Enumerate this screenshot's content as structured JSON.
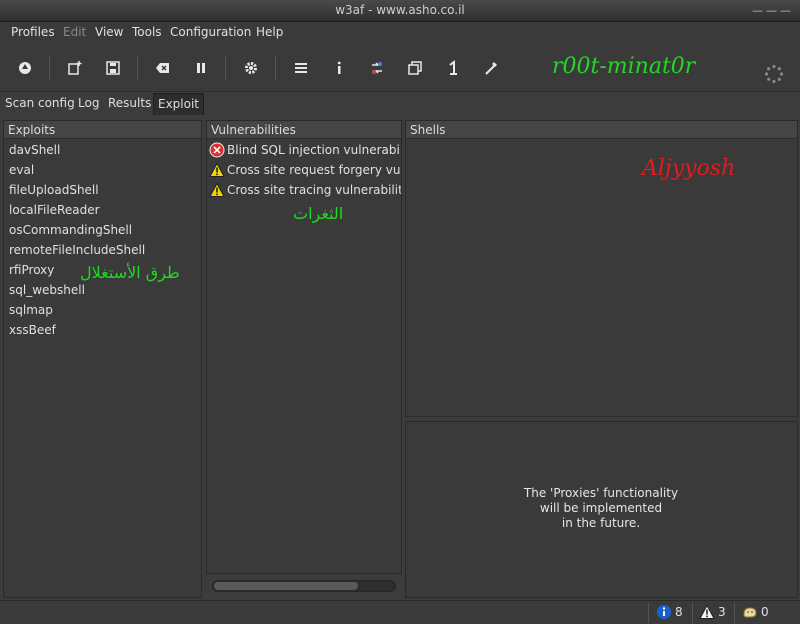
{
  "window": {
    "title": "w3af - www.asho.co.il",
    "controls": "———"
  },
  "menu": {
    "items": [
      {
        "label": "Profiles",
        "enabled": true
      },
      {
        "label": "Edit",
        "enabled": false
      },
      {
        "label": "View",
        "enabled": true
      },
      {
        "label": "Tools",
        "enabled": true
      },
      {
        "label": "Configuration",
        "enabled": true
      },
      {
        "label": "Help",
        "enabled": true
      }
    ]
  },
  "toolbar": {
    "brand_text": "r00t-minat0r",
    "buttons": [
      "start-icon",
      "new-profile-icon",
      "save-icon",
      "clear-icon",
      "pause-icon",
      "settings-icon",
      "list-icon",
      "info-icon",
      "compare-icon",
      "copy-icon",
      "one-icon",
      "wand-icon"
    ]
  },
  "tabs": [
    {
      "label": "Scan config",
      "active": false
    },
    {
      "label": "Log",
      "active": false
    },
    {
      "label": "Results",
      "active": false
    },
    {
      "label": "Exploit",
      "active": true
    }
  ],
  "exploits": {
    "header": "Exploits",
    "items": [
      "davShell",
      "eval",
      "fileUploadShell",
      "localFileReader",
      "osCommandingShell",
      "remoteFileIncludeShell",
      "rfiProxy",
      "sql_webshell",
      "sqlmap",
      "xssBeef"
    ],
    "annotation": "طرق الأستغلال"
  },
  "vulnerabilities": {
    "header": "Vulnerabilities",
    "items": [
      {
        "label": "Blind SQL injection vulnerability",
        "severity": "high"
      },
      {
        "label": "Cross site request forgery vulne",
        "severity": "medium"
      },
      {
        "label": "Cross site tracing vulnerability",
        "severity": "medium"
      }
    ],
    "annotation": "الثغرات",
    "scroll_fraction": 0.8
  },
  "shells": {
    "header": "Shells",
    "annotation": "Aljyyosh"
  },
  "proxies": {
    "line1": "The 'Proxies' functionality",
    "line2": "will be implemented",
    "line3": "in the future."
  },
  "status": {
    "info_count": "8",
    "warning_count": "3",
    "error_count": "0"
  },
  "colors": {
    "annotation_green": "#22d822",
    "annotation_red": "#e21b1b",
    "info_blue": "#1a5fd0",
    "warning_yellow": "#f2d400",
    "error_red": "#d93030"
  }
}
